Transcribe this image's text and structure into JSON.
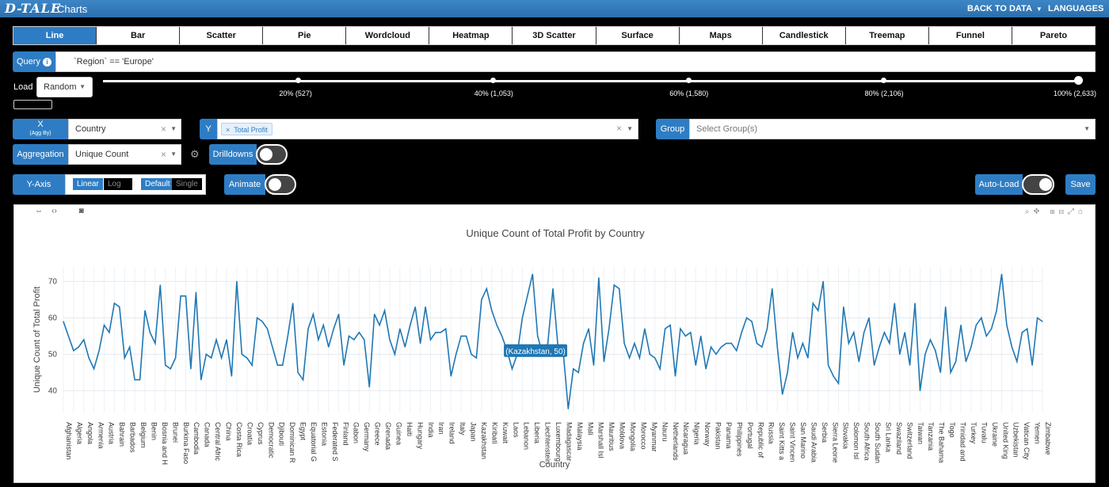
{
  "header": {
    "logo": "D-TALE",
    "title": "Charts",
    "back_label": "BACK TO DATA",
    "languages_label": "LANGUAGES"
  },
  "tabs": [
    "Line",
    "Bar",
    "Scatter",
    "Pie",
    "Wordcloud",
    "Heatmap",
    "3D Scatter",
    "Surface",
    "Maps",
    "Candlestick",
    "Treemap",
    "Funnel",
    "Pareto"
  ],
  "query": {
    "label": "Query",
    "value": "`Region` == 'Europe'"
  },
  "load": {
    "label": "Load",
    "value": "Random",
    "marks": [
      {
        "label": "20% (527)",
        "pct": 20
      },
      {
        "label": "40% (1,053)",
        "pct": 40
      },
      {
        "label": "60% (1,580)",
        "pct": 60
      },
      {
        "label": "80% (2,106)",
        "pct": 80
      },
      {
        "label": "100% (2,633)",
        "pct": 100
      }
    ]
  },
  "x": {
    "label": "X",
    "sublabel": "(Agg By)",
    "value": "Country"
  },
  "y": {
    "label": "Y",
    "chip": "Total Profit"
  },
  "group": {
    "label": "Group",
    "placeholder": "Select Group(s)"
  },
  "aggregation": {
    "label": "Aggregation",
    "value": "Unique Count"
  },
  "drilldowns_label": "Drilldowns",
  "yaxis": {
    "label": "Y-Axis",
    "linear": "Linear",
    "log": "Log",
    "default": "Default",
    "single": "Single"
  },
  "animate_label": "Animate",
  "autoload_label": "Auto-Load",
  "save_label": "Save",
  "chart_data": {
    "type": "line",
    "title": "Unique Count of Total Profit by Country",
    "xlabel": "Country",
    "ylabel": "Unique Count of Total Profit",
    "ylim": [
      34,
      74
    ],
    "yticks": [
      40,
      50,
      60,
      70
    ],
    "grid": true,
    "line_color": "#1f77b4",
    "tooltip": "(Kazakhstan, 50)",
    "tooltip_index": 87,
    "x": [
      "Afghanistan",
      "Albania",
      "Algeria",
      "Andorra",
      "Angola",
      "Antigua",
      "Armenia",
      "Australia",
      "Austria",
      "Azerbaijan",
      "Bahrain",
      "Bangladesh",
      "Barbados",
      "Belarus",
      "Belgium",
      "Belize",
      "Benin",
      "Bhutan",
      "Bosnia and H",
      "Botswana",
      "Brunei",
      "Bulgaria",
      "Burkina Faso",
      "Burundi",
      "Cambodia",
      "Cameroon",
      "Canada",
      "Cape Verde",
      "Central Afric",
      "Chad",
      "China",
      "Colombia",
      "Costa Rica",
      "Cote d'Ivoire",
      "Croatia",
      "Cuba",
      "Cyprus",
      "Czech Rep",
      "Democratic",
      "Denmark",
      "Djibouti",
      "Dominica",
      "Dominican R",
      "East Timor",
      "Egypt",
      "El Salvador",
      "Equatorial G",
      "Eritrea",
      "Estonia",
      "Ethiopia",
      "Federated S",
      "Fiji",
      "Finland",
      "France",
      "Gabon",
      "Georgia",
      "Germany",
      "Ghana",
      "Greece",
      "Greenland",
      "Grenada",
      "Guatemala",
      "Guinea",
      "Guinea-Bissau",
      "Haiti",
      "Honduras",
      "Hungary",
      "Iceland",
      "India",
      "Indonesia",
      "Iran",
      "Iraq",
      "Ireland",
      "Israel",
      "Italy",
      "Jamaica",
      "Japan",
      "Jordan",
      "Kazakhstan",
      "Kenya",
      "Kiribati",
      "Kosovo",
      "Kuwait",
      "Kyrgyzstan",
      "Laos",
      "Latvia",
      "Lebanon",
      "Lesotho",
      "Liberia",
      "Libya",
      "Liechtenstein",
      "Lithuania",
      "Luxembourg",
      "Macedonia",
      "Madagascar",
      "Malawi",
      "Malaysia",
      "Maldives",
      "Mali",
      "Malta",
      "Marshall Isl",
      "Mauritania",
      "Mauritius",
      "Mexico",
      "Moldova",
      "Monaco",
      "Mongolia",
      "Montenegro",
      "Morocco",
      "Mozambique",
      "Myanmar",
      "Namibia",
      "Nauru",
      "Nepal",
      "Netherlands",
      "New Zealand",
      "Nicaragua",
      "Niger",
      "Nigeria",
      "North Korea",
      "Norway",
      "Oman",
      "Pakistan",
      "Palau",
      "Panama",
      "Papua New G",
      "Philippines",
      "Poland",
      "Portugal",
      "Qatar",
      "Republic of",
      "Romania",
      "Russia",
      "Rwanda",
      "Saint Kitts a",
      "Saint Lucia",
      "Saint Vincen",
      "Samoa",
      "San Marino",
      "Sao Tome",
      "Saudi Arabia",
      "Senegal",
      "Serbia",
      "Seychelles",
      "Sierra Leone",
      "Singapore",
      "Slovakia",
      "Slovenia",
      "Solomon Isl",
      "Somalia",
      "South Africa",
      "South Korea",
      "South Sudan",
      "Spain",
      "Sri Lanka",
      "Sudan",
      "Swaziland",
      "Sweden",
      "Switzerland",
      "Syria",
      "Taiwan",
      "Tajikistan",
      "Tanzania",
      "Thailand",
      "The Bahamas",
      "The Gambia",
      "Togo",
      "Tonga",
      "Trinidad and",
      "Tunisia",
      "Turkey",
      "Turkmenistan",
      "Tuvalu",
      "Uganda",
      "Ukraine",
      "United Arab",
      "United Kingd",
      "United States",
      "Uzbekistan",
      "Vanuatu",
      "Vatican City",
      "Vietnam",
      "Yemen",
      "Zambia",
      "Zimbabwe",
      "Zimbabwe "
    ],
    "xtick_labels": [
      "Afghanistan",
      "Algeria",
      "Angola",
      "Armenia",
      "Austria",
      "Bahrain",
      "Barbados",
      "Belgium",
      "Benin",
      "Bosnia and H",
      "Brunei",
      "Burkina Faso",
      "Cambodia",
      "Canada",
      "Central Afric",
      "China",
      "Costa Rica",
      "Croatia",
      "Cyprus",
      "Democratic",
      "Djibouti",
      "Dominican R",
      "Egypt",
      "Equatorial G",
      "Estonia",
      "Federated S",
      "Finland",
      "Gabon",
      "Germany",
      "Greece",
      "Grenada",
      "Guinea",
      "Haiti",
      "Hungary",
      "India",
      "Iran",
      "Ireland",
      "Italy",
      "Japan",
      "Kazakhstan",
      "Kiribati",
      "Kuwait",
      "Laos",
      "Lebanon",
      "Liberia",
      "Liechtenstein",
      "Luxembourg",
      "Madagascar",
      "Malaysia",
      "Mali",
      "Marshall Isl",
      "Mauritius",
      "Moldova",
      "Mongolia",
      "Morocco",
      "Myanmar",
      "Nauru",
      "Netherlands",
      "Nicaragua",
      "Nigeria",
      "Norway",
      "Pakistan",
      "Panama",
      "Philippines",
      "Portugal",
      "Republic of",
      "Russia",
      "Saint Kitts a",
      "Saint Vincen",
      "San Marino",
      "Saudi Arabia",
      "Serbia",
      "Sierra Leone",
      "Slovakia",
      "Solomon Isl",
      "South Africa",
      "South Sudan",
      "Sri Lanka",
      "Swaziland",
      "Switzerland",
      "Taiwan",
      "Tanzania",
      "The Bahama",
      "Togo",
      "Trinidad and",
      "Turkey",
      "Tuvalu",
      "Ukraine",
      "United King",
      "Uzbekistan",
      "Vatican City",
      "Yemen",
      "Zimbabwe"
    ],
    "values": [
      59,
      55,
      51,
      52,
      54,
      49,
      46,
      51,
      58,
      56,
      64,
      63,
      49,
      52,
      43,
      43,
      62,
      56,
      53,
      69,
      47,
      46,
      49,
      66,
      66,
      46,
      67,
      43,
      50,
      49,
      54,
      49,
      54,
      44,
      70,
      50,
      49,
      47,
      60,
      59,
      57,
      52,
      47,
      47,
      55,
      64,
      45,
      43,
      57,
      61,
      54,
      58,
      52,
      57,
      61,
      47,
      55,
      54,
      56,
      54,
      41,
      61,
      58,
      62,
      54,
      50,
      57,
      52,
      58,
      63,
      53,
      63,
      54,
      56,
      56,
      57,
      44,
      50,
      55,
      55,
      50,
      49,
      65,
      68,
      62,
      58,
      55,
      51,
      46,
      50,
      60,
      66,
      72,
      55,
      50,
      53,
      68,
      52,
      51,
      35,
      46,
      45,
      53,
      57,
      47,
      71,
      48,
      57,
      69,
      68,
      53,
      49,
      53,
      49,
      57,
      50,
      49,
      46,
      57,
      58,
      44,
      57,
      55,
      56,
      47,
      55,
      46,
      52,
      50,
      52,
      53,
      53,
      51,
      56,
      60,
      59,
      53,
      52,
      57,
      68,
      52,
      39,
      45,
      56,
      49,
      53,
      49,
      64,
      62,
      70,
      47,
      44,
      42,
      63,
      53,
      56,
      48,
      56,
      60,
      47,
      52,
      56,
      53,
      64,
      50,
      56,
      47,
      64,
      40,
      50,
      54,
      51,
      45,
      63,
      45,
      48,
      58,
      48,
      52,
      58,
      60,
      55,
      57,
      62,
      72,
      58,
      52,
      48,
      56,
      57,
      47,
      60,
      59
    ]
  }
}
